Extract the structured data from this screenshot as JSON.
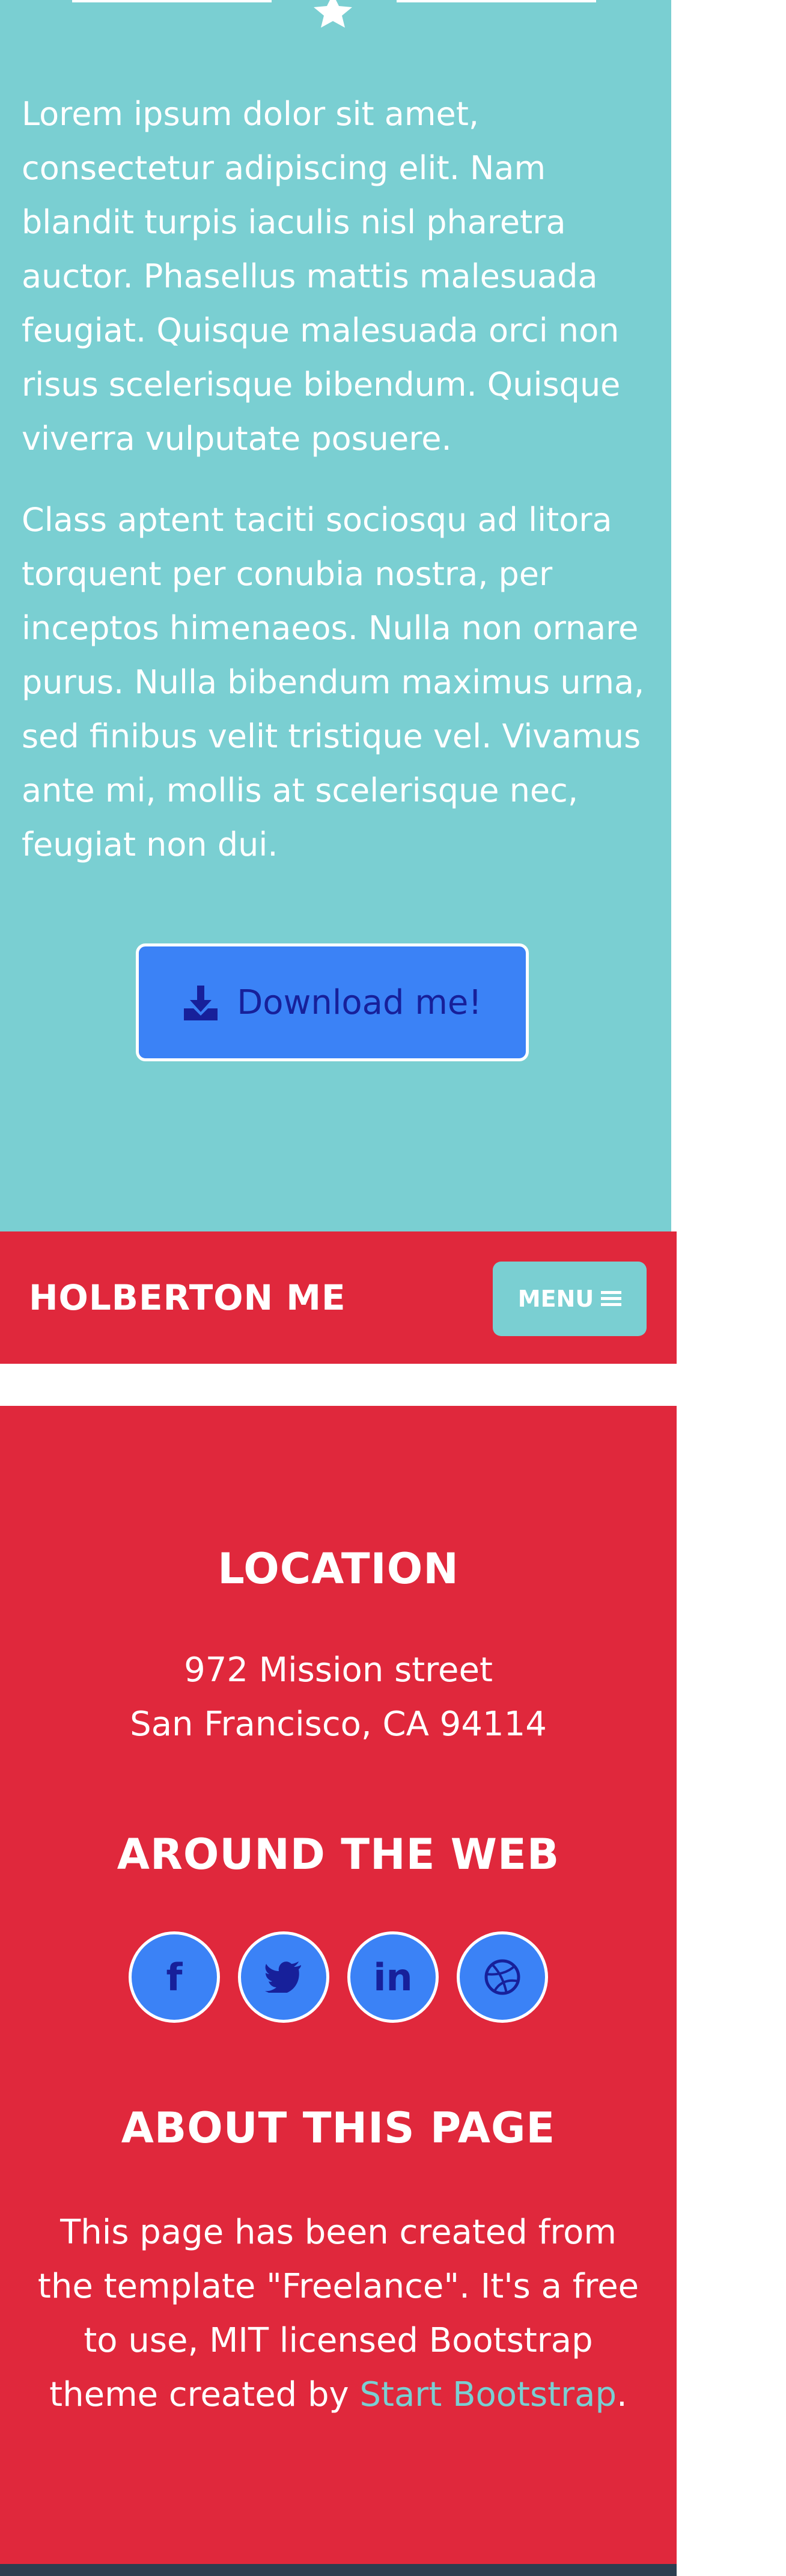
{
  "about": {
    "paragraph_1": "Lorem ipsum dolor sit amet, consectetur adipiscing elit. Nam blandit turpis iaculis nisl pharetra auctor. Phasellus mattis malesuada feugiat. Quisque malesuada orci non risus scelerisque bibendum. Quisque viverra vulputate posuere.",
    "paragraph_2": "Class aptent taciti sociosqu ad litora torquent per conubia nostra, per inceptos himenaeos. Nulla non ornare purus. Nulla bibendum maximus urna, sed finibus velit tristique vel. Vivamus ante mi, mollis at scelerisque nec, feugiat non dui.",
    "download_label": "Download me!",
    "divider_icon": "star-icon",
    "download_icon": "download-icon"
  },
  "navbar": {
    "brand": "HOLBERTON ME",
    "menu_label": "MENU",
    "menu_icon": "bars-icon"
  },
  "footer": {
    "location_heading": "LOCATION",
    "address_line_1": "972 Mission street",
    "address_line_2": "San Francisco, CA 94114",
    "web_heading": "AROUND THE WEB",
    "socials": [
      {
        "icon": "facebook-icon",
        "glyph": "f"
      },
      {
        "icon": "twitter-icon",
        "glyph": ""
      },
      {
        "icon": "linkedin-icon",
        "glyph": "in"
      },
      {
        "icon": "dribbble-icon",
        "glyph": ""
      }
    ],
    "about_heading": "ABOUT THIS PAGE",
    "about_text_before": "This page has been created from the template \"Freelance\". It's a free to use, MIT licensed Bootstrap theme created by ",
    "about_link": "Start Bootstrap",
    "about_text_after": "."
  },
  "colors": {
    "teal": "#7acfd2",
    "red": "#e0283c",
    "blue": "#3b82f6",
    "navy": "#17209a",
    "white": "#ffffff"
  }
}
